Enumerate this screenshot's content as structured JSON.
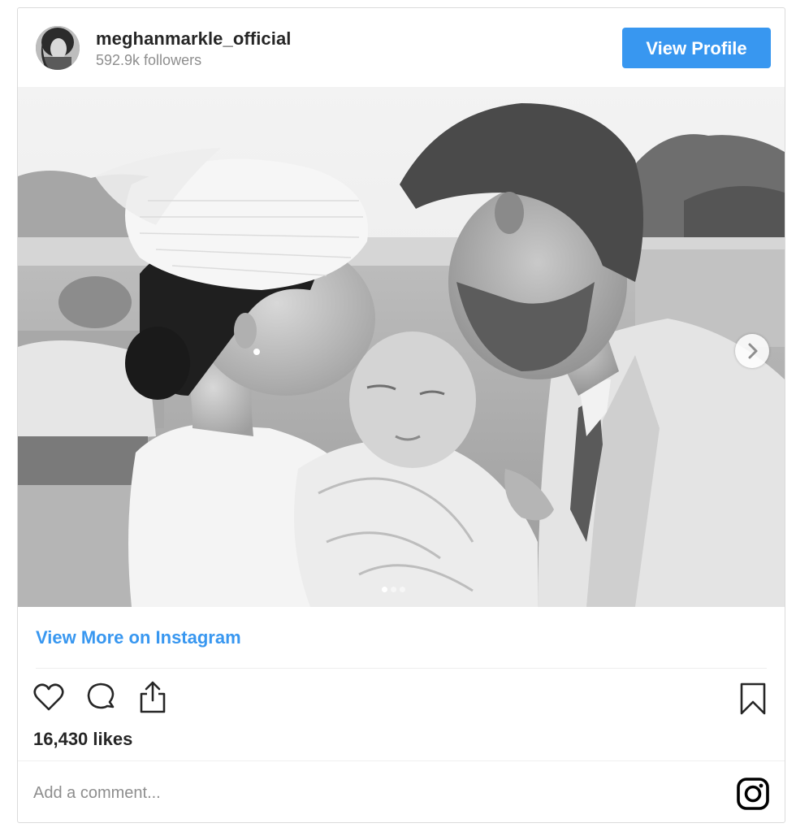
{
  "post": {
    "username": "meghanmarkle_official",
    "followers": "592.9k followers",
    "view_profile_label": "View Profile",
    "view_more_label": "View More on Instagram",
    "likes": "16,430 likes",
    "comment_placeholder": "Add a comment...",
    "carousel": {
      "total_slides": 3,
      "active_slide": 1
    }
  },
  "icons": {
    "like": "heart-icon",
    "comment": "comment-icon",
    "share": "share-icon",
    "save": "bookmark-icon",
    "brand": "instagram-icon",
    "next": "chevron-right-icon"
  },
  "colors": {
    "accent": "#3897f0",
    "text": "#262626",
    "muted": "#8e8e8e",
    "border": "#dbdbdb"
  }
}
